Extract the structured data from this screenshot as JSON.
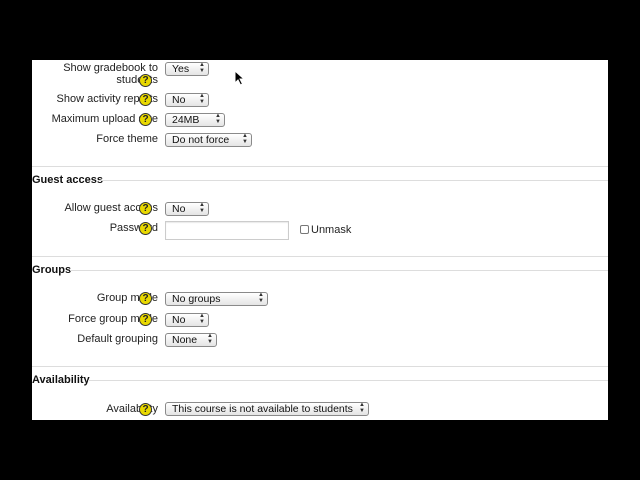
{
  "course_settings": {
    "show_gradebook": {
      "label": "Show gradebook to students",
      "label_line1": "Show gradebook to",
      "label_line2": "students",
      "value": "Yes"
    },
    "show_activity_reports": {
      "label": "Show activity reports",
      "value": "No"
    },
    "max_upload_size": {
      "label": "Maximum upload size",
      "value": "24MB"
    },
    "force_theme": {
      "label": "Force theme",
      "value": "Do not force"
    }
  },
  "guest_access": {
    "title": "Guest access",
    "allow_guest_access": {
      "label": "Allow guest access",
      "value": "No"
    },
    "password": {
      "label": "Password",
      "value": ""
    },
    "unmask": {
      "label": "Unmask",
      "checked": false
    }
  },
  "groups": {
    "title": "Groups",
    "group_mode": {
      "label": "Group mode",
      "value": "No groups"
    },
    "force_group_mode": {
      "label": "Force group mode",
      "value": "No"
    },
    "default_grouping": {
      "label": "Default grouping",
      "value": "None"
    }
  },
  "availability": {
    "title": "Availability",
    "availability": {
      "label": "Availability",
      "value": "This course is not available to students"
    }
  },
  "help_icon_glyph": "?",
  "colors": {
    "help_icon": "#e8d800",
    "page_bg": "#ffffff",
    "letterbox": "#000000"
  }
}
